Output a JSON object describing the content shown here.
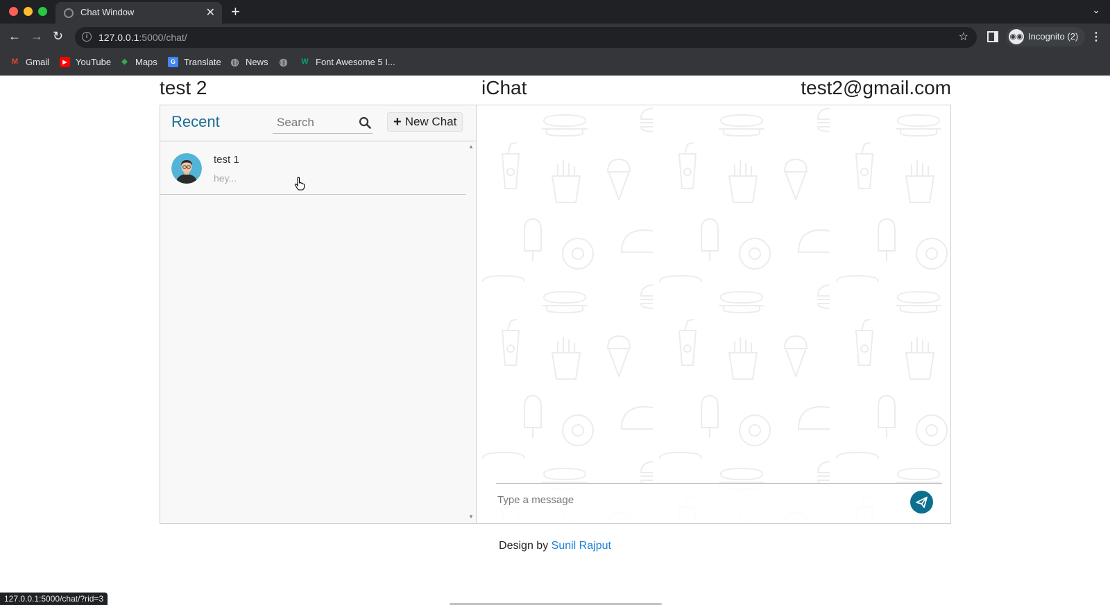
{
  "browser": {
    "tab_title": "Chat Window",
    "url_host": "127.0.0.1",
    "url_path": ":5000/chat/",
    "incognito_label": "Incognito (2)",
    "bookmarks": [
      {
        "label": "Gmail",
        "icon": "gmail-icon",
        "color": "#ea4335"
      },
      {
        "label": "YouTube",
        "icon": "youtube-icon",
        "color": "#ff0000"
      },
      {
        "label": "Maps",
        "icon": "maps-icon",
        "color": "#34a853"
      },
      {
        "label": "Translate",
        "icon": "translate-icon",
        "color": "#4285f4"
      },
      {
        "label": "News",
        "icon": "globe-icon",
        "color": "#9aa0a6"
      },
      {
        "label": "",
        "icon": "globe-icon",
        "color": "#9aa0a6"
      },
      {
        "label": "Font Awesome 5 I...",
        "icon": "font-awesome-icon",
        "color": "#00a86b"
      }
    ],
    "status_url": "127.0.0.1:5000/chat/?rid=3"
  },
  "header": {
    "user_name": "test 2",
    "app_title": "iChat",
    "user_email": "test2@gmail.com"
  },
  "sidebar": {
    "title": "Recent",
    "search_placeholder": "Search",
    "new_chat_label": "New Chat",
    "chats": [
      {
        "name": "test 1",
        "last_message": "hey..."
      }
    ]
  },
  "composer": {
    "placeholder": "Type a message"
  },
  "footer": {
    "prefix": "Design by",
    "author": "Sunil Rajput"
  },
  "colors": {
    "accent": "#0c6f8e",
    "recent_title": "#1b6f93",
    "link": "#1a7fd4"
  }
}
